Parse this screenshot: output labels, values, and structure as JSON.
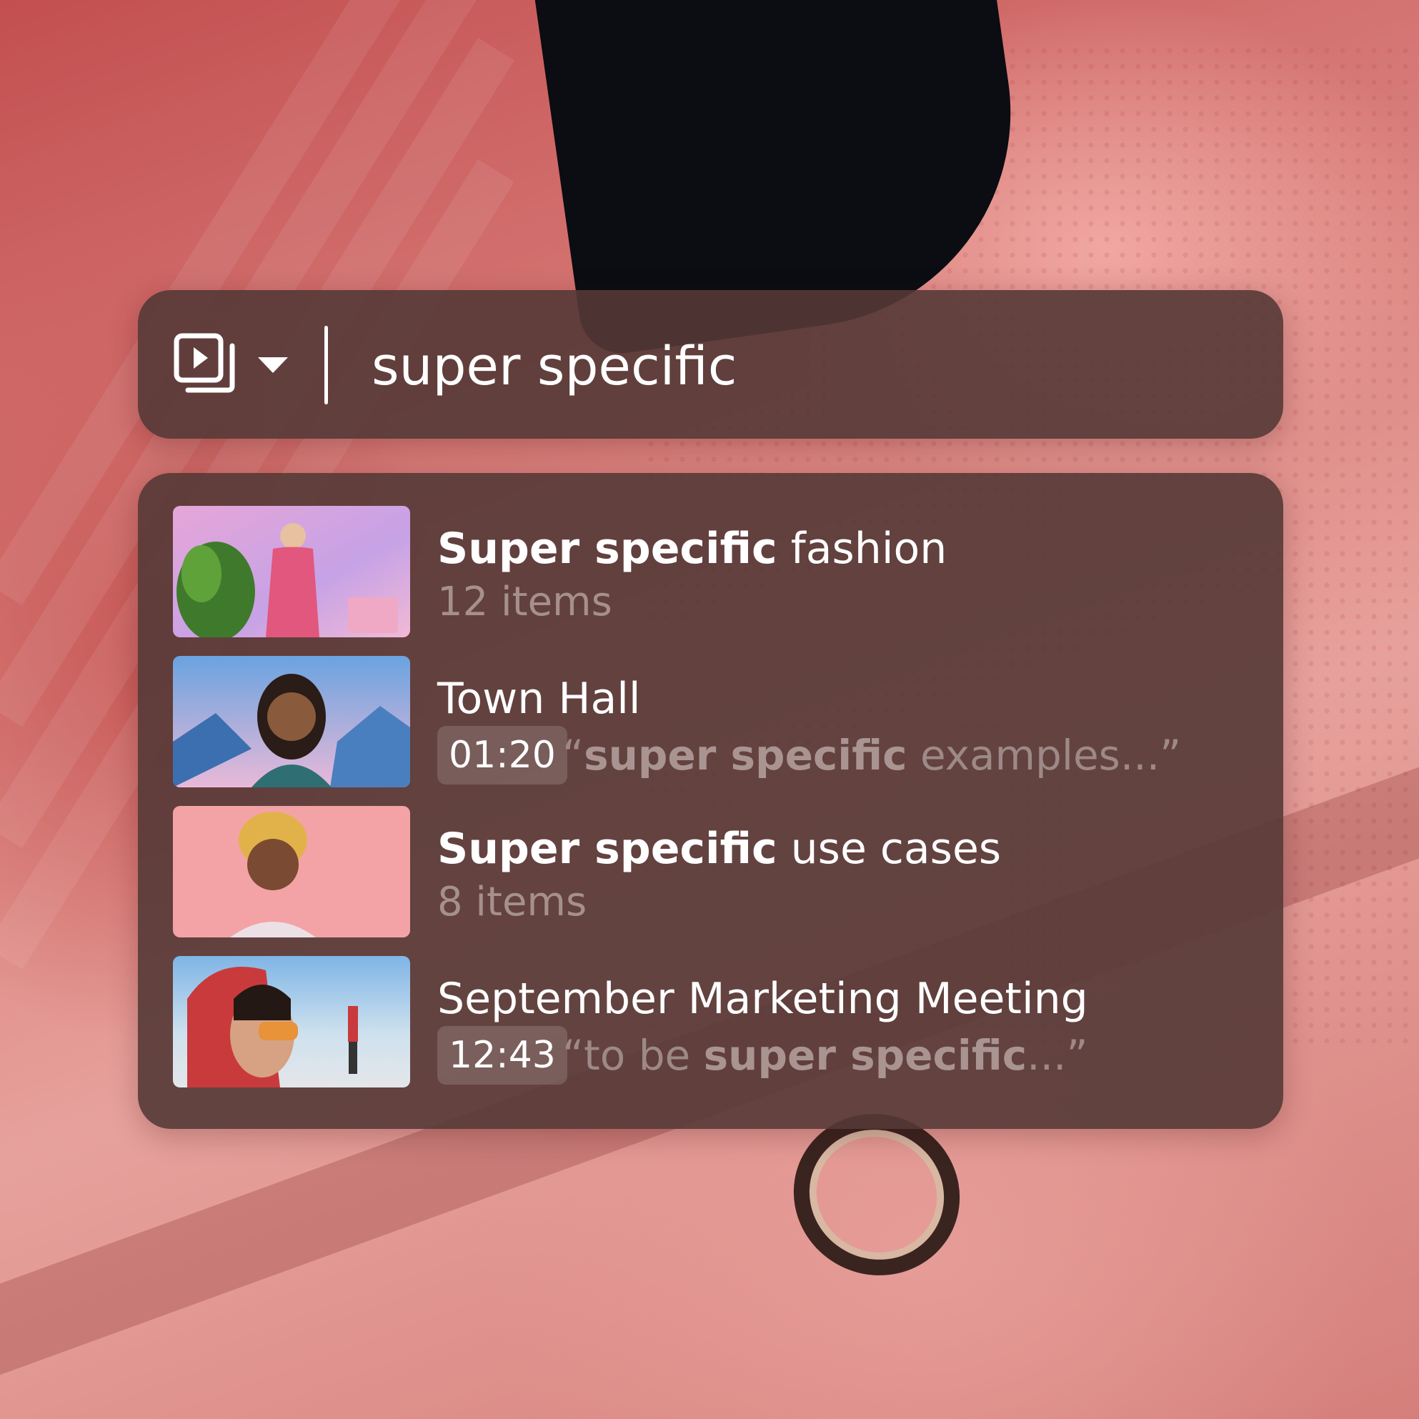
{
  "search": {
    "media_type_icon": "media-stack-icon",
    "dropdown_icon": "caret-down-icon",
    "query": "super specific"
  },
  "results": [
    {
      "title_bold": "Super specific",
      "title_rest": " fashion",
      "subtitle": "12 items",
      "thumbnail": "woman in pink blazer presenting"
    },
    {
      "title_bold": "",
      "title_rest": "Town Hall",
      "timestamp": "01:20",
      "quote_open": "“",
      "quote_bold": "super specific",
      "quote_rest": " examples...”",
      "thumbnail": "smiling woman with braids"
    },
    {
      "title_bold": "Super specific",
      "title_rest": " use cases",
      "subtitle": "8 items",
      "thumbnail": "smiling person on pink background"
    },
    {
      "title_bold": "",
      "title_rest": "September Marketing Meeting",
      "timestamp": "12:43",
      "quote_open": "“to be ",
      "quote_bold": "super specific",
      "quote_rest": "...”",
      "thumbnail": "person in red hood with orange glasses"
    }
  ]
}
